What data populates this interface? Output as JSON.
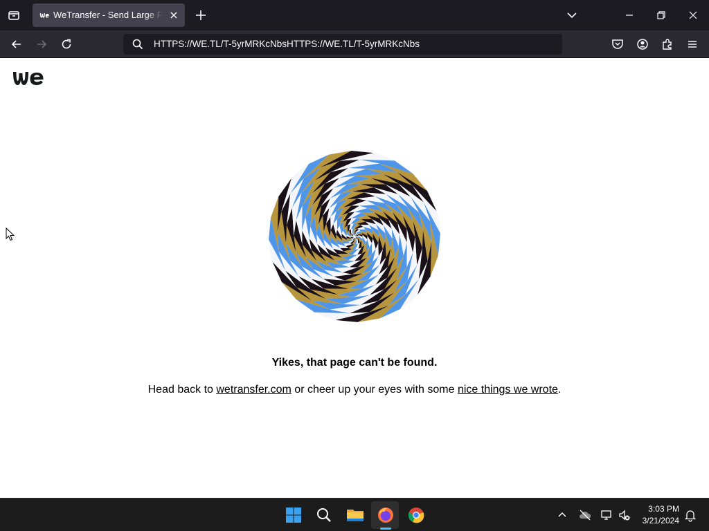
{
  "browser": {
    "tab_title": "WeTransfer - Send Large Files & Share Photos Online",
    "url": "HTTPS://WE.TL/T-5yrMRKcNbsHTTPS://WE.TL/T-5yrMRKcNbs"
  },
  "page": {
    "logo_icon": "wetransfer-logo-icon",
    "image_icon": "spiral-illusion-image",
    "heading": "Yikes, that page can't be found.",
    "line_before": "Head back to ",
    "link1": "wetransfer.com",
    "line_middle": " or cheer up your eyes with some ",
    "link2": "nice things we wrote",
    "line_end": "."
  },
  "taskbar": {
    "time": "3:03 PM",
    "date": "3/21/2024",
    "apps": [
      "windows-start-icon",
      "search-icon",
      "file-explorer-icon",
      "firefox-icon",
      "chrome-icon"
    ]
  },
  "colors": {
    "spiral_gold": "#b8963e",
    "spiral_blue": "#4f95e8",
    "spiral_dark": "#1a1018",
    "spiral_light": "#f4f6fa"
  }
}
